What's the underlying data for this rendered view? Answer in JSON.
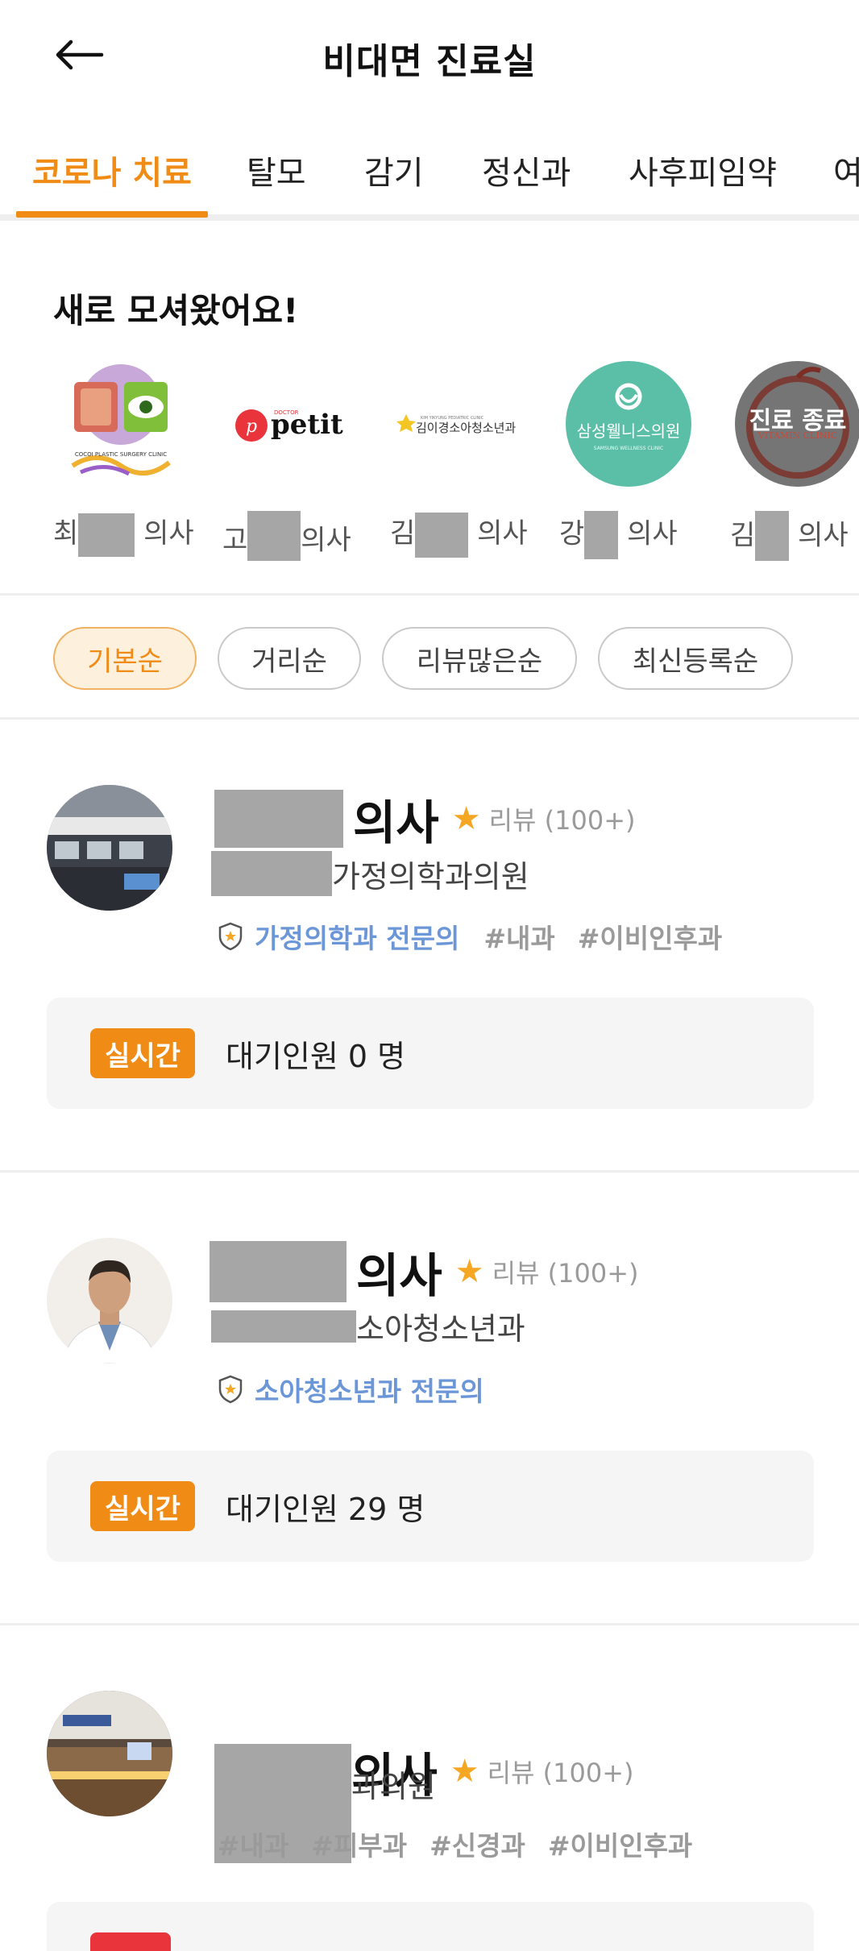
{
  "header": {
    "title": "비대면 진료실"
  },
  "tabs": [
    {
      "label": "코로나 치료",
      "active": true
    },
    {
      "label": "탈모"
    },
    {
      "label": "감기"
    },
    {
      "label": "정신과"
    },
    {
      "label": "사후피임약"
    },
    {
      "label": "여"
    }
  ],
  "new_doctors": {
    "title": "새로 모셔왔어요!",
    "items": [
      {
        "logo_text": "COCOI PLASTIC SURGERY CLINIC",
        "caption_prefix": "최",
        "caption_suffix": "의사"
      },
      {
        "logo_small": "DOCTOR",
        "logo_text": "petit",
        "caption_prefix": "고",
        "caption_suffix": "의사"
      },
      {
        "logo_text": "김이경소아청소년과",
        "caption_prefix": "김",
        "caption_suffix": "의사"
      },
      {
        "logo_text": "삼성웰니스의원",
        "logo_sub": "SAMSUNG WELLNESS CLINIC",
        "caption_prefix": "강",
        "caption_suffix": "의사"
      },
      {
        "logo_text": "진료 종료",
        "logo_sub": "VITAMIN CLINIC",
        "caption_prefix": "김",
        "caption_suffix": "의사"
      }
    ]
  },
  "sort_options": [
    {
      "label": "기본순",
      "active": true
    },
    {
      "label": "거리순"
    },
    {
      "label": "리뷰많은순"
    },
    {
      "label": "최신등록순"
    }
  ],
  "cards": [
    {
      "doctor_suffix": "의사",
      "review": "리뷰 (100+)",
      "clinic_visible": "가정의학과의원",
      "specialty": "가정의학과 전문의",
      "tags": [
        "#내과",
        "#이비인후과"
      ],
      "realtime": "실시간",
      "waiting": "대기인원 0 명"
    },
    {
      "doctor_suffix": "의사",
      "review": "리뷰 (100+)",
      "clinic_visible": "소아청소년과",
      "specialty": "소아청소년과 전문의",
      "tags": [],
      "realtime": "실시간",
      "waiting": "대기인원 29 명"
    },
    {
      "doctor_suffix": "의사",
      "review": "리뷰 (100+)",
      "clinic_visible": "과의원",
      "specialty": "",
      "tags": [
        "#내과",
        "#피부과",
        "#신경과",
        "#이비인후과"
      ]
    }
  ],
  "colors": {
    "accent": "#f08b16",
    "specialty_blue": "#6b96d8",
    "grey_text": "#9a9a9a",
    "closed_red": "#e8343a"
  },
  "icons": [
    "back-arrow-icon",
    "star-icon",
    "specialist-badge-icon"
  ]
}
